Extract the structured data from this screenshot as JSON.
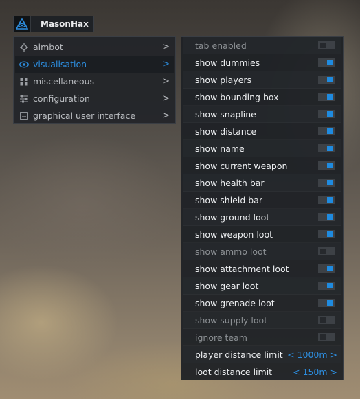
{
  "app": {
    "title": "MasonHax",
    "logo_icon": "eye-triangle-icon"
  },
  "colors": {
    "accent": "#2d8ee0",
    "panel": "#1e2125",
    "text": "#eceef0",
    "muted": "#8c9094"
  },
  "menu": {
    "items": [
      {
        "label": "aimbot",
        "icon": "crosshair-icon",
        "arrow": ">",
        "active": false
      },
      {
        "label": "visualisation",
        "icon": "eye-icon",
        "arrow": ">",
        "active": true
      },
      {
        "label": "miscellaneous",
        "icon": "grid-icon",
        "arrow": ">",
        "active": false
      },
      {
        "label": "configuration",
        "icon": "sliders-icon",
        "arrow": ">",
        "active": false
      },
      {
        "label": "graphical user interface",
        "icon": "window-icon",
        "arrow": ">",
        "active": false
      }
    ]
  },
  "settings": {
    "rows": [
      {
        "label": "tab enabled",
        "enabled": false
      },
      {
        "label": "show dummies",
        "enabled": true
      },
      {
        "label": "show players",
        "enabled": true
      },
      {
        "label": "show bounding box",
        "enabled": true
      },
      {
        "label": "show snapline",
        "enabled": true
      },
      {
        "label": "show distance",
        "enabled": true
      },
      {
        "label": "show name",
        "enabled": true
      },
      {
        "label": "show current weapon",
        "enabled": true
      },
      {
        "label": "show health bar",
        "enabled": true
      },
      {
        "label": "show shield bar",
        "enabled": true
      },
      {
        "label": "show ground loot",
        "enabled": true
      },
      {
        "label": "show weapon loot",
        "enabled": true
      },
      {
        "label": "show ammo loot",
        "enabled": false
      },
      {
        "label": "show attachment loot",
        "enabled": true
      },
      {
        "label": "show gear loot",
        "enabled": true
      },
      {
        "label": "show grenade loot",
        "enabled": true
      },
      {
        "label": "show supply loot",
        "enabled": false
      },
      {
        "label": "ignore team",
        "enabled": false
      }
    ],
    "sliders": [
      {
        "label": "player distance limit",
        "value": "< 1000m >"
      },
      {
        "label": "loot distance limit",
        "value": "< 150m >"
      }
    ]
  }
}
